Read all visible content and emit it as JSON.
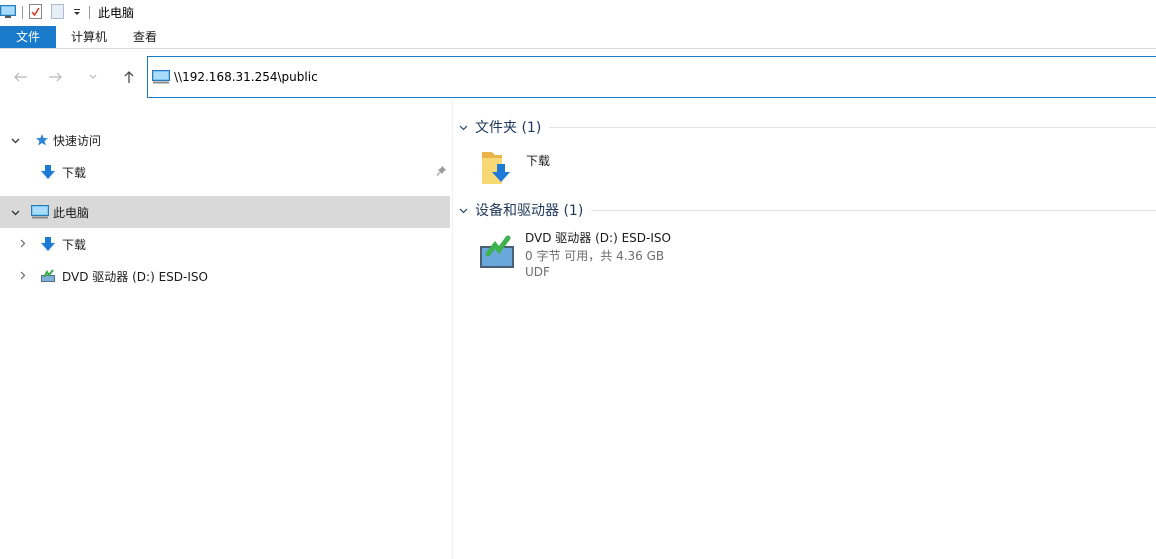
{
  "window": {
    "title": "此电脑"
  },
  "quick_access_toolbar": {
    "icons": [
      "computer-icon",
      "properties-icon",
      "new-folder-icon",
      "customize-dropdown-icon"
    ]
  },
  "ribbon": {
    "tabs": [
      {
        "label": "文件",
        "active": true,
        "color": "#1979ca"
      },
      {
        "label": "计算机"
      },
      {
        "label": "查看"
      }
    ]
  },
  "navigation": {
    "back_icon": "back-arrow-icon",
    "forward_icon": "forward-arrow-icon",
    "recent_icon": "chevron-down-icon",
    "up_icon": "up-arrow-icon"
  },
  "address_bar": {
    "value": "\\\\192.168.31.254\\public"
  },
  "sidebar": {
    "quick_access": {
      "label": "快速访问",
      "icon": "star-pin-icon"
    },
    "quick_access_items": [
      {
        "label": "下载",
        "icon": "download-icon",
        "pinned": true
      }
    ],
    "this_pc": {
      "label": "此电脑",
      "icon": "computer-icon",
      "selected": true
    },
    "this_pc_items": [
      {
        "label": "下载",
        "icon": "download-icon"
      },
      {
        "label": "DVD 驱动器 (D:) ESD-ISO",
        "icon": "dvd-drive-icon"
      }
    ]
  },
  "content": {
    "folders_group": {
      "header": "文件夹 (1)",
      "items": [
        {
          "label": "下载",
          "icon": "downloads-folder-icon"
        }
      ]
    },
    "devices_group": {
      "header": "设备和驱动器 (1)",
      "items": [
        {
          "label": "DVD 驱动器 (D:) ESD-ISO",
          "space": "0 字节 可用，共 4.36 GB",
          "filesystem": "UDF",
          "icon": "dvd-drive-icon"
        }
      ]
    }
  },
  "colors": {
    "accent": "#1979ca",
    "selected_row": "#d9d9d9",
    "group_header": "#1e395b"
  }
}
